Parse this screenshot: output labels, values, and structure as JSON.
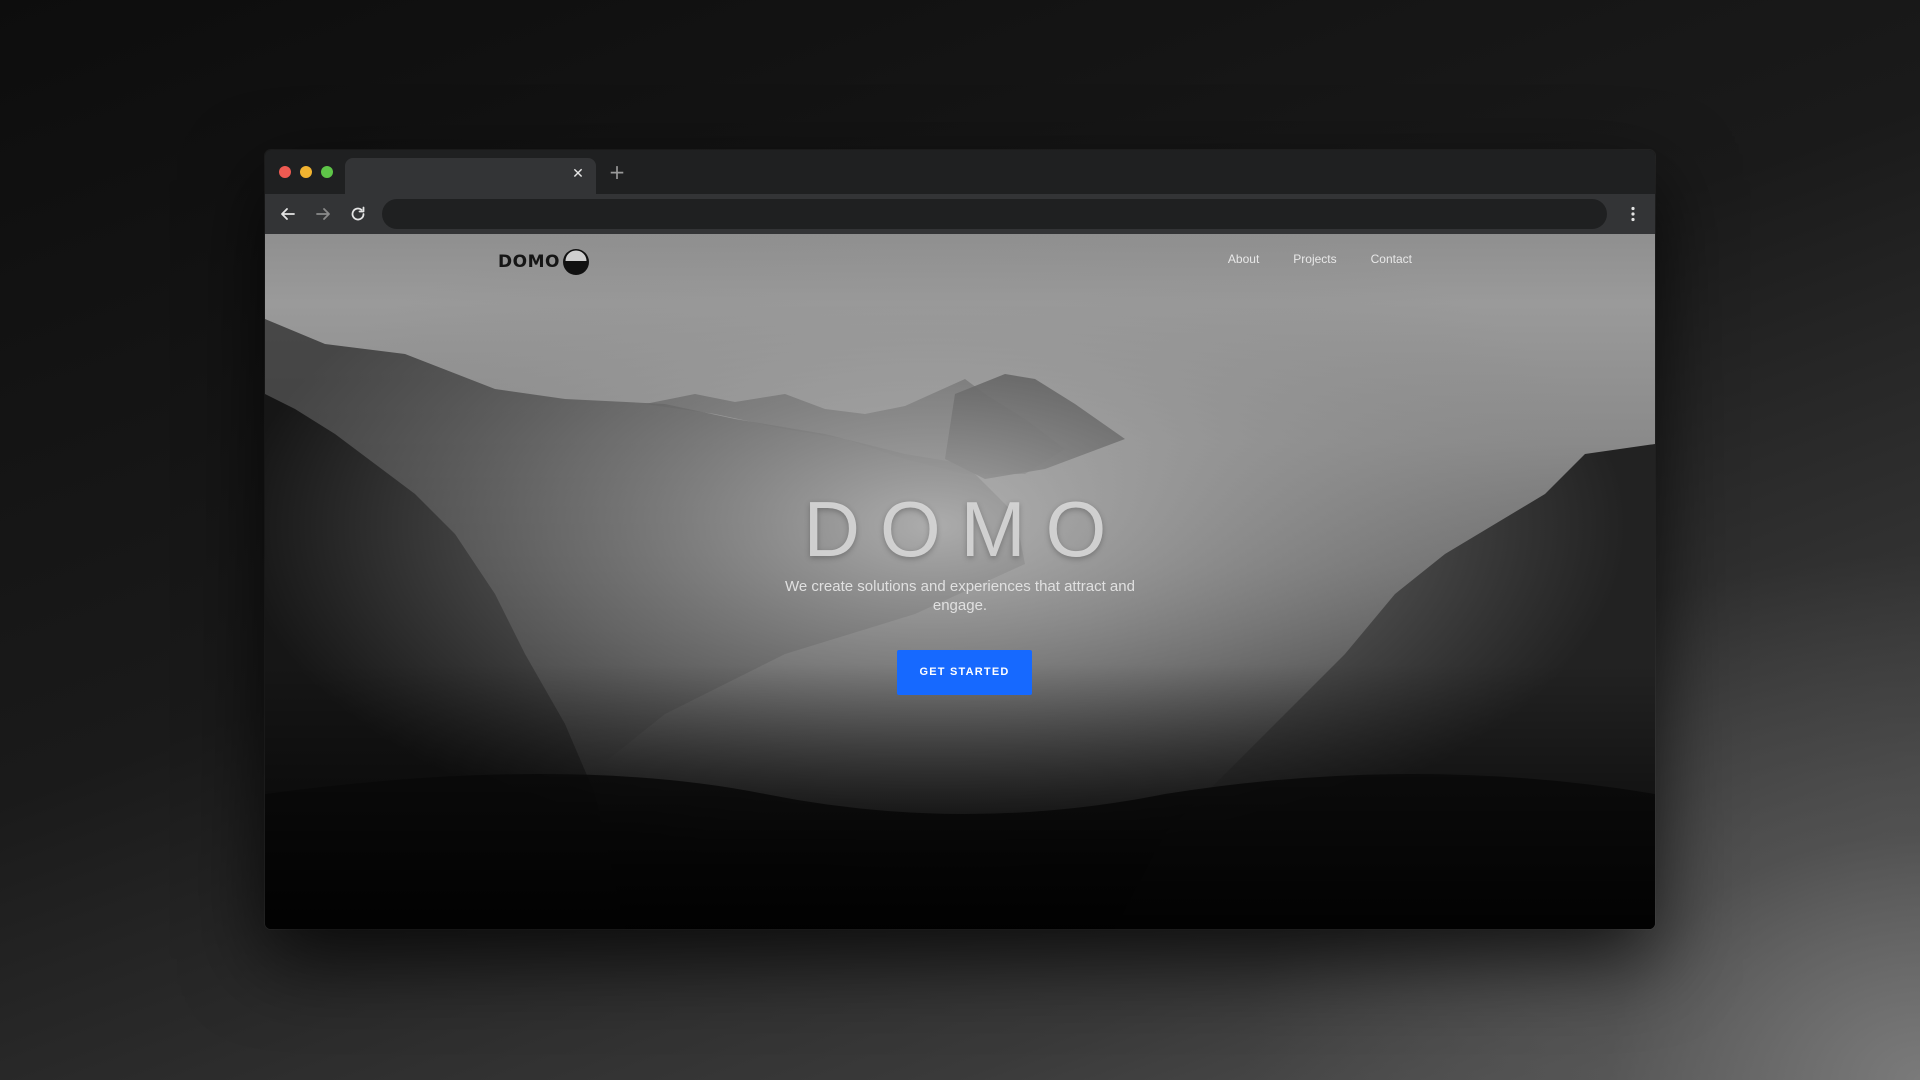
{
  "browser": {
    "tab": {
      "title": "",
      "close_icon": "close-icon"
    },
    "new_tab_label": "+",
    "address": "",
    "icons": {
      "back": "arrow-left-icon",
      "forward": "arrow-right-icon",
      "reload": "reload-icon",
      "menu": "vertical-dots-icon"
    },
    "traffic_lights": {
      "close": "#ee5a52",
      "minimize": "#f1b330",
      "maximize": "#5ec548"
    }
  },
  "site": {
    "logo_text": "DOMO",
    "nav": [
      {
        "label": "About"
      },
      {
        "label": "Projects"
      },
      {
        "label": "Contact"
      }
    ],
    "hero": {
      "title": "DOMO",
      "subtitle": "We create solutions and experiences that attract and engage.",
      "cta_label": "GET STARTED"
    },
    "colors": {
      "cta": "#1669ff"
    }
  }
}
